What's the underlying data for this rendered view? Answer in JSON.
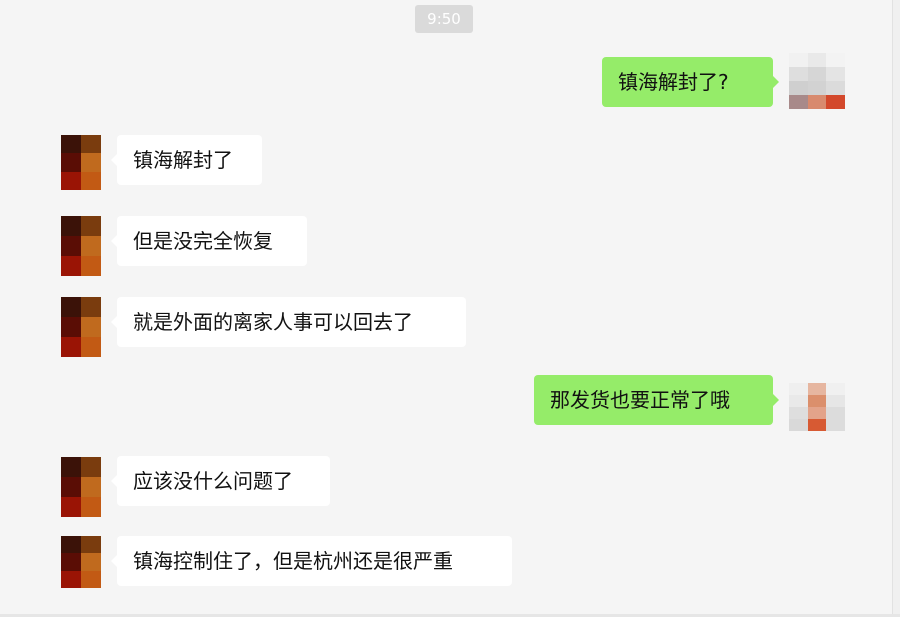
{
  "time_badge": "9:50",
  "colors": {
    "chat_background": "#f5f5f5",
    "incoming_bubble": "#ffffff",
    "outgoing_bubble": "#95ec69",
    "time_badge_background": "#dadada"
  },
  "messages": [
    {
      "direction": "outgoing",
      "text": "镇海解封了?"
    },
    {
      "direction": "incoming",
      "text": "镇海解封了"
    },
    {
      "direction": "incoming",
      "text": "但是没完全恢复"
    },
    {
      "direction": "incoming",
      "text": "就是外面的离家人事可以回去了"
    },
    {
      "direction": "outgoing",
      "text": "那发货也要正常了哦"
    },
    {
      "direction": "incoming",
      "text": "应该没什么问题了"
    },
    {
      "direction": "incoming",
      "text": "镇海控制住了，但是杭州还是很严重"
    }
  ],
  "avatars": {
    "incoming": "pixelated-avatar",
    "outgoing": "pixelated-avatar"
  }
}
